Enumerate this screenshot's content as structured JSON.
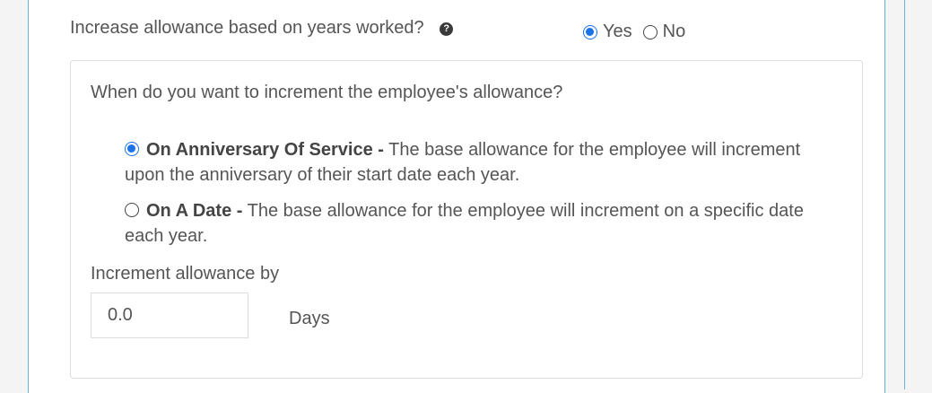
{
  "question": {
    "label": "Increase allowance based on years worked?",
    "help_icon": "question-circle-icon",
    "options": [
      {
        "label": "Yes",
        "selected": true
      },
      {
        "label": "No",
        "selected": false
      }
    ]
  },
  "panel": {
    "question": "When do you want to increment the employee's allowance?",
    "choices": [
      {
        "title": "On Anniversary Of Service -",
        "text": " The base allowance for the employee will increment upon the anniversary of their start date each year.",
        "selected": true
      },
      {
        "title": "On A Date -",
        "text": " The base allowance for the employee will increment on a specific date each year.",
        "selected": false
      }
    ],
    "increment": {
      "label": "Increment allowance by",
      "value": "0.0",
      "unit": "Days"
    }
  },
  "colors": {
    "accent": "#1a73e8",
    "border": "#6ab0d8"
  }
}
